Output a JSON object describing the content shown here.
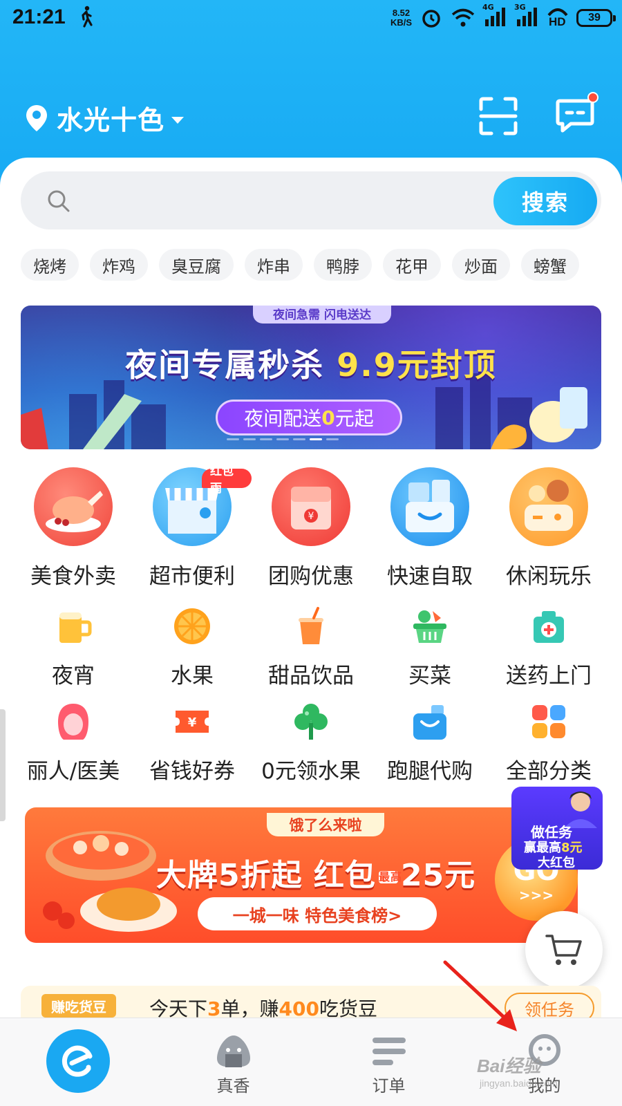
{
  "status_bar": {
    "time": "21:21",
    "net_speed_value": "8.52",
    "net_speed_unit": "KB/S",
    "signal_4g": "4G",
    "signal_3g": "3G",
    "hd": "HD",
    "battery": "39"
  },
  "header": {
    "location": "水光十色",
    "icons": [
      "location-pin-icon",
      "scan-icon",
      "message-icon"
    ],
    "has_unread_dot": true
  },
  "search": {
    "placeholder": "",
    "button_label": "搜索"
  },
  "hot_tags": [
    "烧烤",
    "炸鸡",
    "臭豆腐",
    "炸串",
    "鸭脖",
    "花甲",
    "炒面",
    "螃蟹"
  ],
  "banner": {
    "top_pill": "夜间急需 闪电送达",
    "headline_main": "夜间专属秒杀 ",
    "headline_highlight": "9.9元封顶",
    "sub_pre": "夜间配送",
    "sub_zero": "0",
    "sub_post": "元起",
    "page_count": 7,
    "active_page_index": 5
  },
  "main_categories": [
    {
      "label": "美食外卖",
      "icon": "roast-chicken-icon"
    },
    {
      "label": "超市便利",
      "icon": "store-icon",
      "badge": "红包雨"
    },
    {
      "label": "团购优惠",
      "icon": "coupon-bag-icon"
    },
    {
      "label": "快速自取",
      "icon": "pickup-box-icon"
    },
    {
      "label": "休闲玩乐",
      "icon": "game-controller-icon"
    }
  ],
  "categories_row2": [
    {
      "label": "夜宵",
      "icon": "beer-mug-icon"
    },
    {
      "label": "水果",
      "icon": "orange-slice-icon"
    },
    {
      "label": "甜品饮品",
      "icon": "drink-cup-icon"
    },
    {
      "label": "买菜",
      "icon": "vegetable-basket-icon"
    },
    {
      "label": "送药上门",
      "icon": "medicine-box-icon"
    }
  ],
  "categories_row3": [
    {
      "label": "丽人/医美",
      "icon": "woman-face-icon"
    },
    {
      "label": "省钱好券",
      "icon": "ticket-icon"
    },
    {
      "label": "0元领水果",
      "icon": "fruit-tree-icon"
    },
    {
      "label": "跑腿代购",
      "icon": "shopping-bag-icon"
    },
    {
      "label": "全部分类",
      "icon": "grid-icon"
    }
  ],
  "promo": {
    "brand": "饿了么来啦",
    "headline_a": "大牌5折起 红包",
    "headline_mini": "最高",
    "headline_b": "25元",
    "rank_link": "一城一味 特色美食榜>",
    "go_label": "GO",
    "go_arrows": ">>>"
  },
  "task_float": {
    "line1": "做任务",
    "line2_pre": "赢最高",
    "line2_hl": "8元",
    "line3": "大红包"
  },
  "task_strip": {
    "label": "赚吃货豆",
    "text_pre": "今天下",
    "text_n1": "3",
    "text_mid": "单，赚",
    "text_n2": "400",
    "text_post": "吃货豆",
    "button": "领任务"
  },
  "tabbar": {
    "tabs": [
      {
        "label": "",
        "icon": "eleme-logo-icon",
        "active": true
      },
      {
        "label": "真香",
        "icon": "onigiri-icon"
      },
      {
        "label": "订单",
        "icon": "order-list-icon"
      },
      {
        "label": "我的",
        "icon": "profile-icon"
      }
    ]
  },
  "watermark": {
    "line1": "Bai经验",
    "line2": "jingyan.baidu.com"
  },
  "colors": {
    "brand_blue": "#1aa8f2",
    "accent_red": "#ff4d2a",
    "annotation_red": "#e8221b"
  }
}
